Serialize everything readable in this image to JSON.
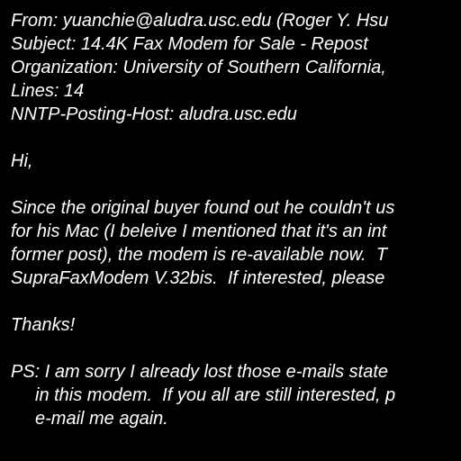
{
  "headers": {
    "from": "From: yuanchie@aludra.usc.edu (Roger Y. Hsu",
    "subject": "Subject: 14.4K Fax Modem for Sale - Repost",
    "organization": "Organization: University of Southern California,",
    "lines": "Lines: 14",
    "nntp_host": "NNTP-Posting-Host: aludra.usc.edu"
  },
  "greeting": "Hi,",
  "body_lines": [
    "Since the original buyer found out he couldn't us",
    "for his Mac (I beleive I mentioned that it's an int",
    "former post), the modem is re-available now.  T",
    "SupraFaxModem V.32bis.  If interested, please"
  ],
  "thanks": "Thanks!",
  "ps_lines": [
    "PS: I am sorry I already lost those e-mails state",
    "in this modem.  If you all are still interested, p",
    "e-mail me again."
  ],
  "colors": {
    "background": "#000000",
    "text": "#ffffff"
  }
}
